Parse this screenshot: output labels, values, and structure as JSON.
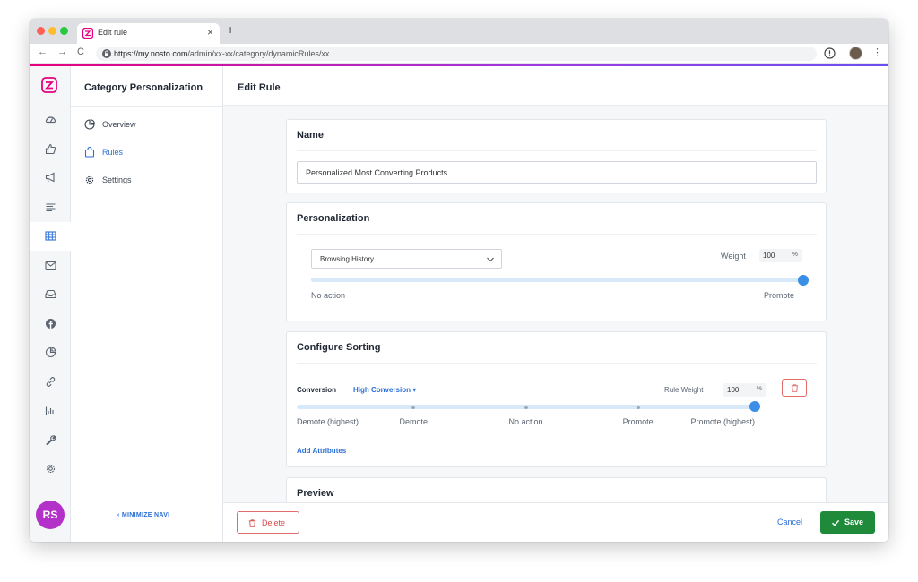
{
  "browser": {
    "tab_title": "Edit rule",
    "tab_close": "×",
    "new_tab": "+",
    "url_host": "https://my.nosto.com",
    "url_path": "/admin/xx-xx/category/dynamicRules/xx",
    "back": "←",
    "forward": "→",
    "reload": "C",
    "menu": "⋮"
  },
  "colors": {
    "brand_pink": "#e6007e",
    "link_blue": "#2b6fd6",
    "save_green": "#1f8b3a",
    "danger_red": "#d84a4a",
    "avatar_purple": "#b331c9"
  },
  "rail": {
    "items": [
      "dashboard-icon",
      "thumbs-up-icon",
      "megaphone-icon",
      "list-icon",
      "grid-icon",
      "mail-icon",
      "inbox-icon",
      "facebook-icon",
      "pie-chart-icon",
      "link-icon",
      "bar-chart-icon",
      "wrench-icon",
      "gear-icon"
    ],
    "active_index": 4,
    "avatar": "RS"
  },
  "subnav": {
    "title": "Category Personalization",
    "items": [
      {
        "label": "Overview",
        "icon": "pie-chart-icon"
      },
      {
        "label": "Rules",
        "icon": "bag-icon"
      },
      {
        "label": "Settings",
        "icon": "gear-icon"
      }
    ],
    "active_index": 1,
    "minimize": "‹ MINIMIZE NAVI"
  },
  "main": {
    "title": "Edit Rule",
    "name_card": {
      "title": "Name",
      "value": "Personalized Most Converting Products"
    },
    "personalization": {
      "title": "Personalization",
      "select_value": "Browsing History",
      "weight_label": "Weight",
      "weight_value": "100",
      "weight_unit": "%",
      "slider_value": 1.0,
      "min_label": "No action",
      "max_label": "Promote"
    },
    "sorting": {
      "title": "Configure Sorting",
      "attribute_label": "Conversion",
      "attribute_value": "High Conversion",
      "dropdown_caret": "▾",
      "weight_label": "Rule Weight",
      "weight_value": "100",
      "weight_unit": "%",
      "slider_value": 1.0,
      "stops": [
        "Demote (highest)",
        "Demote",
        "No action",
        "Promote",
        "Promote (highest)"
      ],
      "add_attributes": "Add Attributes"
    },
    "preview": {
      "title": "Preview"
    }
  },
  "footer": {
    "delete": "Delete",
    "cancel": "Cancel",
    "save": "Save"
  }
}
